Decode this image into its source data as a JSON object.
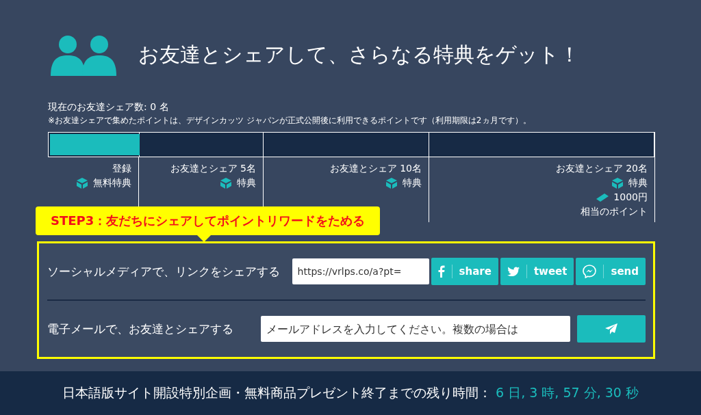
{
  "header": {
    "title": "お友達とシェアして、さらなる特典をゲット！"
  },
  "share_count": "現在のお友達シェア数: 0 名",
  "note": "※お友達シェアで集めたポイントは、デザインカッツ ジャパンが正式公開後に利用できるポイントです（利用期限は2ヵ月です）。",
  "progress": {
    "level": 0.15
  },
  "tiers": [
    {
      "label": "登録",
      "reward": "無料特典"
    },
    {
      "label": "お友達とシェア 5名",
      "reward": "特典"
    },
    {
      "label": "お友達とシェア 10名",
      "reward": "特典"
    },
    {
      "label": "お友達とシェア 20名",
      "reward": "特典",
      "points": "1000円",
      "points_note": "相当のポイント"
    }
  ],
  "callout": "STEP3：友だちにシェアしてポイントリワードをためる",
  "social": {
    "label": "ソーシャルメディアで、リンクをシェアする",
    "link": "https://vrlps.co/a?pt=",
    "buttons": [
      {
        "kind": "facebook",
        "label": "share"
      },
      {
        "kind": "twitter",
        "label": "tweet"
      },
      {
        "kind": "messenger",
        "label": "send"
      }
    ]
  },
  "email": {
    "label": "電子メールで、お友達とシェアする",
    "placeholder": "メールアドレスを入力してください。複数の場合は"
  },
  "footer": {
    "text": "日本語版サイト開設特別企画・無料商品プレゼント終了までの残り時間：",
    "countdown": "6 日, 3 時, 57 分, 30 秒"
  }
}
